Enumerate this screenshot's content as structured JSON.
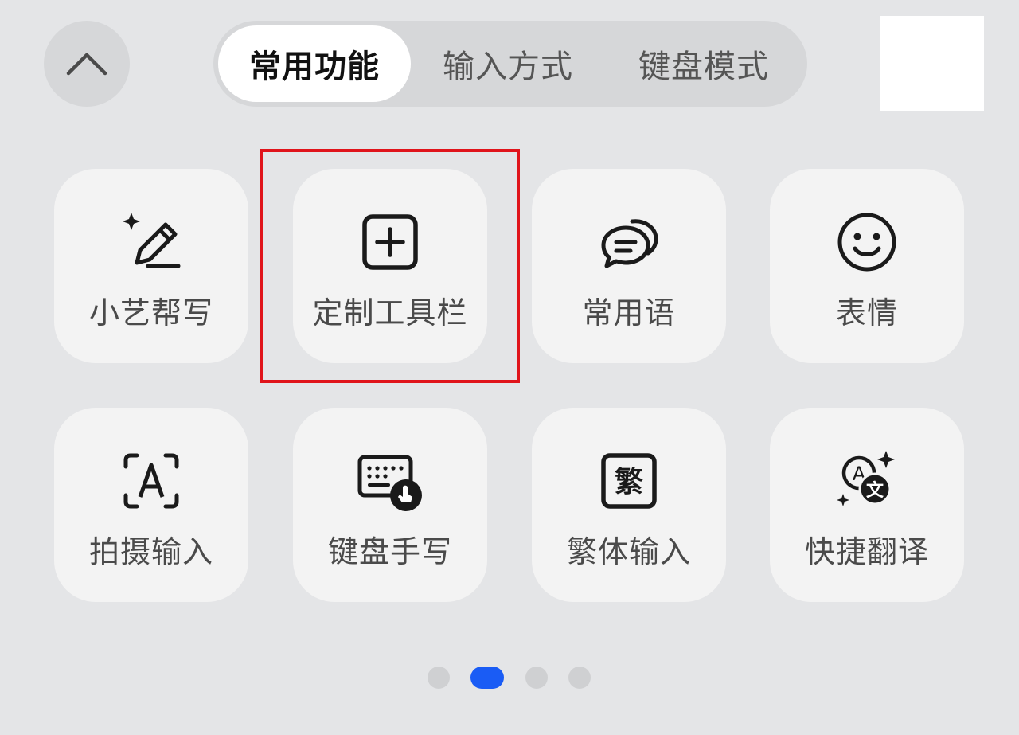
{
  "tabs": [
    {
      "label": "常用功能",
      "active": true
    },
    {
      "label": "输入方式",
      "active": false
    },
    {
      "label": "键盘模式",
      "active": false
    }
  ],
  "tiles": [
    {
      "label": "小艺帮写",
      "icon": "ai-write-pencil-icon"
    },
    {
      "label": "定制工具栏",
      "icon": "add-square-icon"
    },
    {
      "label": "常用语",
      "icon": "chat-bubbles-icon"
    },
    {
      "label": "表情",
      "icon": "smiley-face-icon"
    },
    {
      "label": "拍摄输入",
      "icon": "camera-text-scan-icon"
    },
    {
      "label": "键盘手写",
      "icon": "keyboard-handwriting-icon"
    },
    {
      "label": "繁体输入",
      "icon": "traditional-chinese-icon",
      "glyph": "繁"
    },
    {
      "label": "快捷翻译",
      "icon": "quick-translate-icon",
      "glyph_a": "A",
      "glyph_b": "文"
    }
  ],
  "pager": {
    "current": 2,
    "total": 4
  },
  "colors": {
    "accent": "#1a5cf5",
    "highlight": "#e0141b"
  }
}
